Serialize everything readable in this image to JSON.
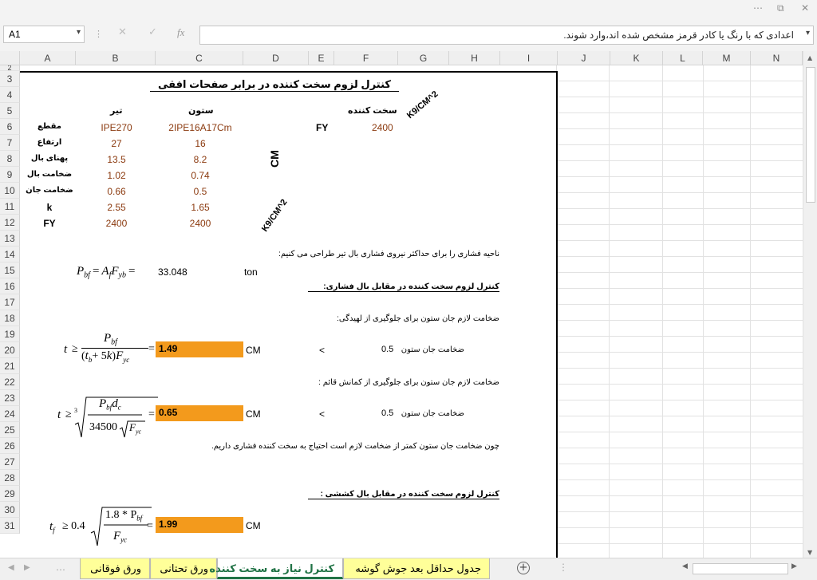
{
  "window_controls": {
    "menu": "⋯",
    "restore": "⧉",
    "close": "✕"
  },
  "name_box": "A1",
  "formula_bar": {
    "cancel": "✕",
    "enter": "✓",
    "fx": "fx",
    "content": "اعدادی که با رنگ یا کادر قرمز مشخص شده اند،وارد شوند."
  },
  "columns": [
    "A",
    "B",
    "C",
    "D",
    "E",
    "F",
    "G",
    "H",
    "I",
    "J",
    "K",
    "L",
    "M",
    "N"
  ],
  "rows": [
    "2",
    "3",
    "4",
    "5",
    "6",
    "7",
    "8",
    "9",
    "10",
    "11",
    "12",
    "13",
    "14",
    "15",
    "16",
    "17",
    "18",
    "19",
    "20",
    "21",
    "22",
    "23",
    "24",
    "25",
    "26",
    "27",
    "28",
    "29",
    "30",
    "31"
  ],
  "sheet": {
    "title": "کنترل لزوم سخت کننده در برابر صفحات افقی",
    "hdr_beam": "تیر",
    "hdr_column": "ستون",
    "hdr_stiffener": "سخت کننده",
    "unit_kg_top": "K9/CM^2",
    "unit_kg_mid": "K9/CM^2",
    "unit_cm": "CM",
    "labels": [
      "مقطع",
      "ارتفاع",
      "پهنای بال",
      "ضخامت بال",
      "ضخامت جان",
      "k",
      "FY"
    ],
    "beam": [
      "IPE270",
      "27",
      "13.5",
      "1.02",
      "0.66",
      "2.55",
      "2400"
    ],
    "column": [
      "2IPE16A17Cm",
      "16",
      "8.2",
      "0.74",
      "0.5",
      "1.65",
      "2400"
    ],
    "fy_label": "FY",
    "fy_value": "2400",
    "r13": "ناحیه فشاری را برای حداکثر نیروی فشاری بال تیر طراحی می کنیم:",
    "pbf_value": "33.048",
    "pbf_unit": "ton",
    "r15": "کنترل لزوم سخت کننده در مقابل بال فشاری:",
    "r18": "ضخامت لازم جان ستون برای جلوگیری از لهیدگی:",
    "r19_result": "1.49",
    "r19_unit": "CM",
    "r19_cmp": "<",
    "r19_text": "ضخامت جان ستون",
    "r19_val": "0.5",
    "r21": "ضخامت لازم جان ستون برای جلوگیری از کمانش قائم :",
    "r23_result": "0.65",
    "r23_unit": "CM",
    "r23_cmp": "<",
    "r23_text": "ضخامت جان ستون",
    "r23_val": "0.5",
    "r25": "چون ضخامت جان ستون کمتر از ضخامت لازم است احتیاج به سخت کننده فشاری داریم.",
    "r28": "کنترل لزوم سخت کننده در مقابل بال کششی :",
    "r30_result": "1.99",
    "r30_unit": "CM"
  },
  "formulas": {
    "f14": {
      "lhs": "P",
      "lhs_sub": "bf",
      "eq": "=",
      "a": "A",
      "a_sub": "f",
      "f": "F",
      "f_sub": "yb",
      "eq2": "="
    },
    "f19": {
      "t": "t",
      "ge": "≥",
      "num": "P",
      "num_sub": "bf",
      "den_open": "(",
      "den_t": "t",
      "den_t_sub": "b",
      "den_plus": "+ 5",
      "den_k": "k",
      "den_close": ")",
      "den_f": "F",
      "den_f_sub": "yc",
      "eq": "="
    },
    "f23": {
      "t": "t",
      "ge": "≥",
      "root_idx": "3",
      "num": "P",
      "num_sub": "bf",
      "num_d": "d",
      "num_d_sub": "c",
      "den": "34500",
      "den_f": "F",
      "den_f_sub": "yc",
      "eq": "="
    },
    "f30": {
      "t": "t",
      "t_sub": "f",
      "ge": "≥ 0.4",
      "num": "1.8 * P",
      "num_sub": "bf",
      "den_f": "F",
      "den_f_sub": "yc",
      "eq": "="
    }
  },
  "tabs": [
    "ورق فوقانی",
    "ورق تحتانی",
    "کنترل نیاز به سخت کننده",
    "جدول حداقل بعد جوش گوشه"
  ],
  "tab_colors": {
    "sheet": "#ffff99",
    "active_text": "#217346",
    "highlight": "#f39a1c"
  }
}
